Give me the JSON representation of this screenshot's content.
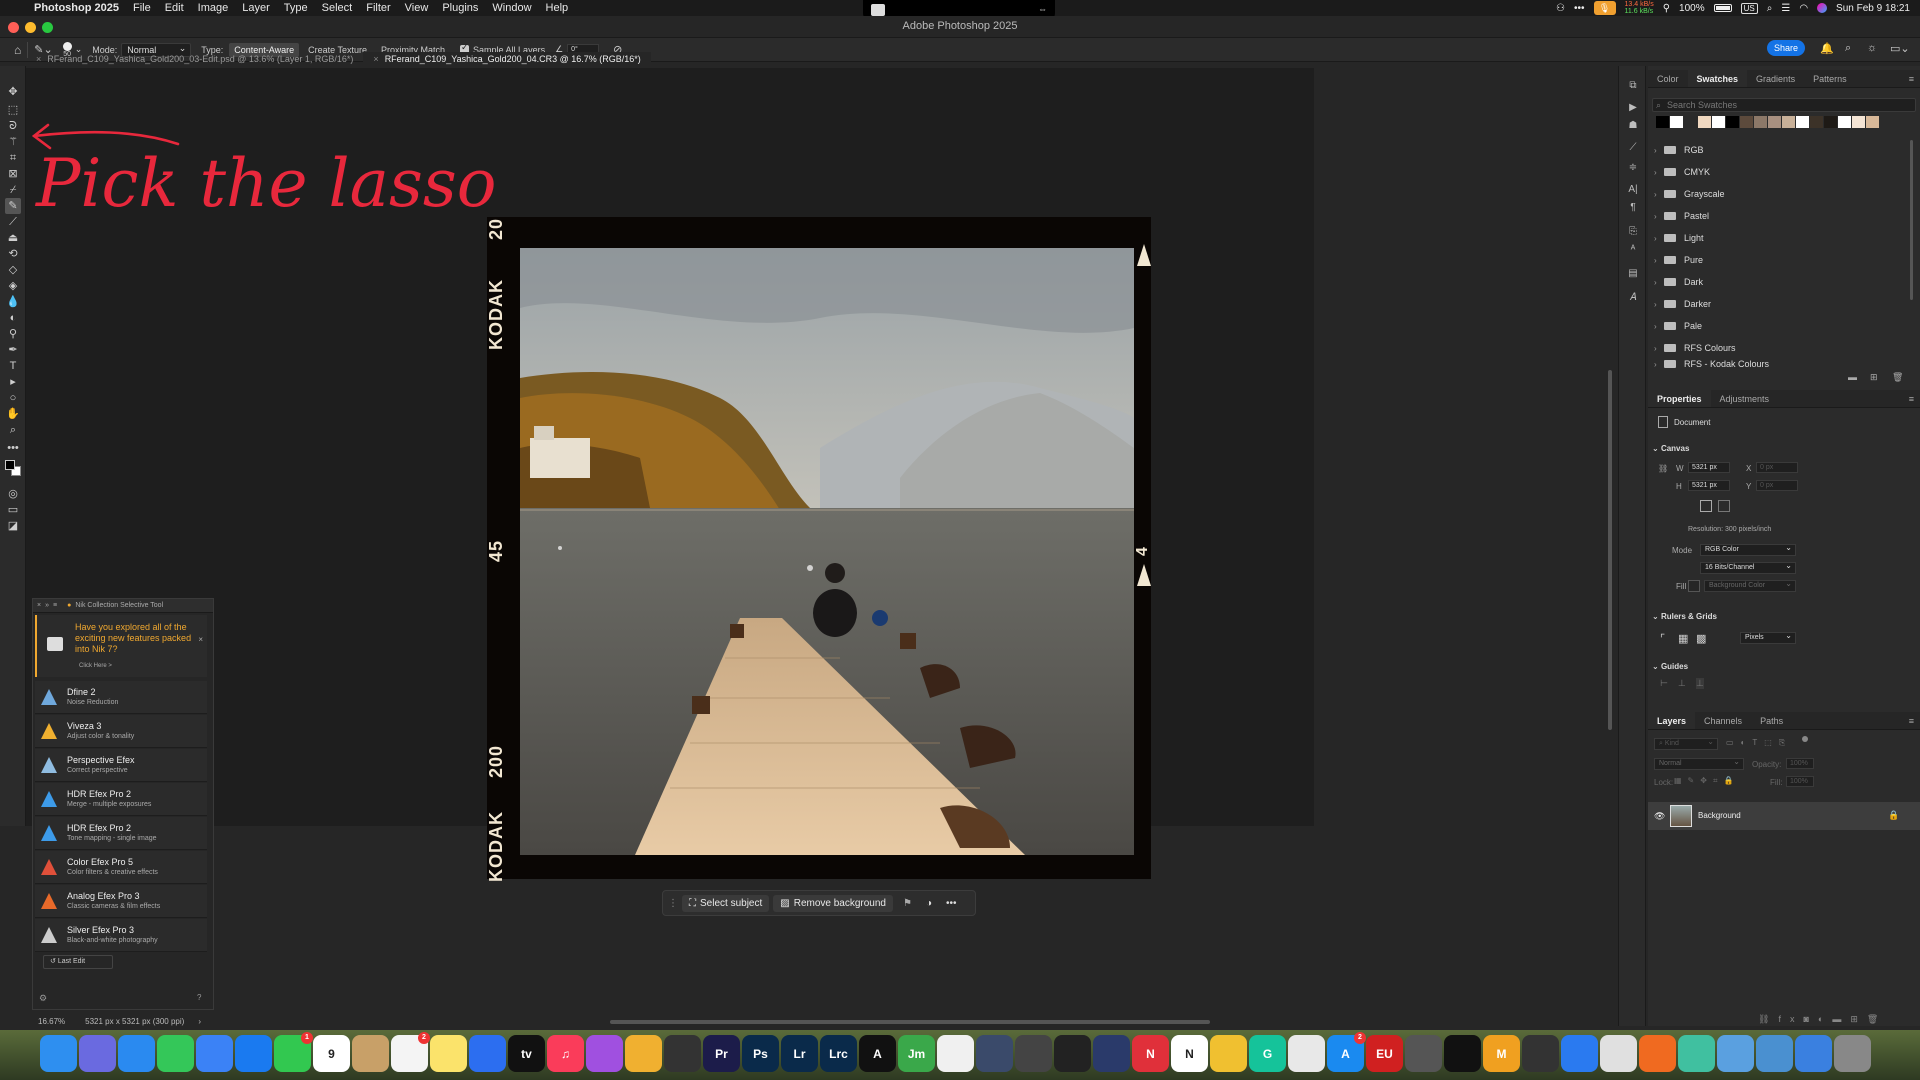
{
  "menubar": {
    "app_name": "Photoshop 2025",
    "items": [
      "File",
      "Edit",
      "Image",
      "Layer",
      "Type",
      "Select",
      "Filter",
      "View",
      "Plugins",
      "Window",
      "Help"
    ],
    "net_up": "13.4 kB/s",
    "net_down": "11.6 kB/s",
    "battery": "100%",
    "input_source": "US",
    "datetime": "Sun Feb 9  18:21"
  },
  "window": {
    "title": "Adobe Photoshop 2025"
  },
  "options": {
    "brush_size": "50",
    "mode_label": "Mode:",
    "mode_value": "Normal",
    "type_label": "Type:",
    "type_options": [
      "Content-Aware",
      "Create Texture",
      "Proximity Match"
    ],
    "sample_all_layers": "Sample All Layers",
    "angle": "0°",
    "share": "Share"
  },
  "doc_tabs": [
    {
      "label": "RFerand_C109_Yashica_Gold200_03-Edit.psd @ 13.6% (Layer 1, RGB/16*)"
    },
    {
      "label": "RFerand_C109_Yashica_Gold200_04.CR3 @ 16.7% (RGB/16*)"
    }
  ],
  "annotation": {
    "text": "Pick the lasso tool",
    "color": "#e8283c"
  },
  "film": {
    "brand": "KODAK",
    "frame_top": "20",
    "frame_mid": "45",
    "frame_bot": "200",
    "frame_right": "4"
  },
  "context_bar": {
    "select_subject": "Select subject",
    "remove_background": "Remove background"
  },
  "nik": {
    "title": "Nik Collection Selective Tool",
    "promo": "Have you explored all of the exciting new features packed into Nik 7?",
    "promo_link": "Click Here >",
    "items": [
      {
        "name": "Dfine 2",
        "desc": "Noise Reduction",
        "color": "#6fa8dc"
      },
      {
        "name": "Viveza 3",
        "desc": "Adjust color & tonality",
        "color": "#f0b030"
      },
      {
        "name": "Perspective Efex",
        "desc": "Correct perspective",
        "color": "#8fbce0"
      },
      {
        "name": "HDR Efex Pro 2",
        "desc": "Merge - multiple exposures",
        "color": "#3d9be9"
      },
      {
        "name": "HDR Efex Pro 2",
        "desc": "Tone mapping - single image",
        "color": "#3d9be9"
      },
      {
        "name": "Color Efex Pro 5",
        "desc": "Color filters & creative effects",
        "color": "#e0503a"
      },
      {
        "name": "Analog Efex Pro 3",
        "desc": "Classic cameras & film effects",
        "color": "#e86a2a"
      },
      {
        "name": "Silver Efex Pro 3",
        "desc": "Black-and-white photography",
        "color": "#cccccc"
      }
    ],
    "last_edit": "Last Edit"
  },
  "status": {
    "zoom": "16.67%",
    "doc_size": "5321 px x 5321 px (300 ppi)"
  },
  "swatches_panel": {
    "tabs": [
      "Color",
      "Swatches",
      "Gradients",
      "Patterns"
    ],
    "active_tab": "Swatches",
    "search_placeholder": "Search Swatches",
    "recent": [
      "#000000",
      "#ffffff",
      "#2a2a2a",
      "#f0d8c0",
      "#ffffff",
      "#000000",
      "#5c4a3c",
      "#8c7868",
      "#a89080",
      "#c8b098",
      "#ffffff",
      "#3c3228",
      "#1e1a16",
      "#ffffff",
      "#f4e4d4",
      "#d8b898"
    ],
    "folders": [
      "RGB",
      "CMYK",
      "Grayscale",
      "Pastel",
      "Light",
      "Pure",
      "Dark",
      "Darker",
      "Pale",
      "RFS Colours",
      "RFS - Kodak Colours"
    ]
  },
  "properties_panel": {
    "tabs": [
      "Properties",
      "Adjustments"
    ],
    "doc_label": "Document",
    "canvas_label": "Canvas",
    "w_label": "W",
    "w_value": "5321 px",
    "h_label": "H",
    "h_value": "5321 px",
    "x_label": "X",
    "x_value": "0 px",
    "y_label": "Y",
    "y_value": "0 px",
    "resolution": "Resolution: 300 pixels/inch",
    "mode_label": "Mode",
    "mode_value": "RGB Color",
    "bits_value": "16 Bits/Channel",
    "fill_label": "Fill",
    "fill_value": "Background Color",
    "rulers_label": "Rulers & Grids",
    "units_value": "Pixels",
    "guides_label": "Guides"
  },
  "layers_panel": {
    "tabs": [
      "Layers",
      "Channels",
      "Paths"
    ],
    "kind_placeholder": "Kind",
    "blend_value": "Normal",
    "opacity_label": "Opacity:",
    "opacity_value": "100%",
    "lock_label": "Lock:",
    "fill_label": "Fill:",
    "fill_value": "100%",
    "layer_name": "Background"
  },
  "dock": {
    "apps": [
      {
        "label": "",
        "color": "#2e8ff0"
      },
      {
        "label": "",
        "color": "#6a6ae0"
      },
      {
        "label": "",
        "color": "#2a8af0"
      },
      {
        "label": "",
        "color": "#34c759"
      },
      {
        "label": "",
        "color": "#3b82f6"
      },
      {
        "label": "",
        "color": "#1a7af0"
      },
      {
        "label": "",
        "color": "#32c850",
        "badge": "1"
      },
      {
        "label": "9",
        "color": "#ffffff"
      },
      {
        "label": "",
        "color": "#c8a068"
      },
      {
        "label": "",
        "color": "#f4f4f4",
        "badge": "2"
      },
      {
        "label": "",
        "color": "#fbe36b"
      },
      {
        "label": "",
        "color": "#2c6ef0"
      },
      {
        "label": "tv",
        "color": "#111111"
      },
      {
        "label": "♫",
        "color": "#fa3c5a"
      },
      {
        "label": "",
        "color": "#a050e0"
      },
      {
        "label": "",
        "color": "#f0b030"
      },
      {
        "label": "",
        "color": "#333333"
      },
      {
        "label": "Pr",
        "color": "#1c1c4a"
      },
      {
        "label": "Ps",
        "color": "#0a2a4a"
      },
      {
        "label": "Lr",
        "color": "#0a2a4a"
      },
      {
        "label": "Lrc",
        "color": "#0a2a4a"
      },
      {
        "label": "A",
        "color": "#111111"
      },
      {
        "label": "Jm",
        "color": "#3aa84a"
      },
      {
        "label": "",
        "color": "#f0f0f0"
      },
      {
        "label": "",
        "color": "#3a4a6a"
      },
      {
        "label": "",
        "color": "#444444"
      },
      {
        "label": "",
        "color": "#222222"
      },
      {
        "label": "",
        "color": "#2a3a6a"
      },
      {
        "label": "N",
        "color": "#e0303a"
      },
      {
        "label": "N",
        "color": "#ffffff"
      },
      {
        "label": "",
        "color": "#f0c030"
      },
      {
        "label": "G",
        "color": "#15c39a"
      },
      {
        "label": "",
        "color": "#e8e8e8"
      },
      {
        "label": "A",
        "color": "#1a8af0",
        "badge": "2"
      },
      {
        "label": "EU",
        "color": "#d02020"
      },
      {
        "label": "",
        "color": "#555555"
      },
      {
        "label": "",
        "color": "#111111"
      },
      {
        "label": "M",
        "color": "#f0a020"
      },
      {
        "label": "",
        "color": "#333333"
      },
      {
        "label": "",
        "color": "#2a7af0"
      },
      {
        "label": "",
        "color": "#e0e0e0"
      },
      {
        "label": "",
        "color": "#f06a20"
      },
      {
        "label": "",
        "color": "#40c0a0"
      },
      {
        "label": "",
        "color": "#5aa0e0"
      },
      {
        "label": "",
        "color": "#4a90d0"
      },
      {
        "label": "",
        "color": "#3a80e0"
      },
      {
        "label": "",
        "color": "#888888"
      }
    ]
  }
}
